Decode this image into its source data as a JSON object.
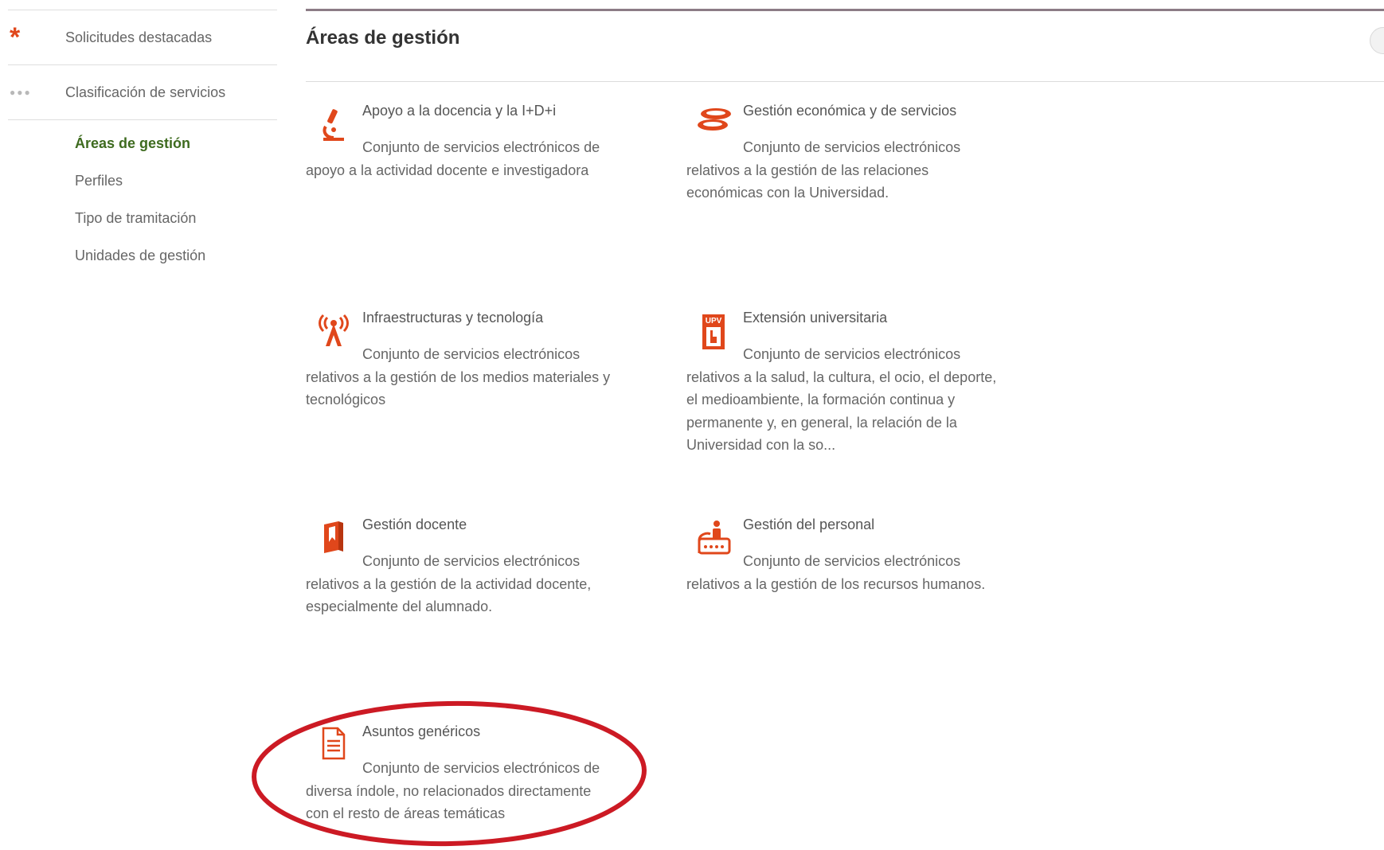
{
  "sidebar": {
    "featured": {
      "label": "Solicitudes destacadas",
      "icon": "asterisk-icon"
    },
    "classification": {
      "label": "Clasificación de servicios",
      "icon": "ellipsis-icon"
    },
    "subitems": [
      {
        "label": "Áreas de gestión",
        "active": true
      },
      {
        "label": "Perfiles",
        "active": false
      },
      {
        "label": "Tipo de tramitación",
        "active": false
      },
      {
        "label": "Unidades de gestión",
        "active": false
      }
    ]
  },
  "main": {
    "title": "Áreas de gestión",
    "areas": [
      {
        "title": "Apoyo a la docencia y la I+D+i",
        "description": "Conjunto de servicios electrónicos de apoyo a la actividad docente e investigadora",
        "icon": "microscope-icon"
      },
      {
        "title": "Gestión económica y de servicios",
        "description": "Conjunto de servicios electrónicos relativos a la gestión de las relaciones económicas con la Universidad.",
        "icon": "coins-icon"
      },
      {
        "title": "Infraestructuras y tecnología",
        "description": "Conjunto de servicios electrónicos relativos a la gestión de los medios materiales y tecnológicos",
        "icon": "antenna-icon"
      },
      {
        "title": "Extensión universitaria",
        "description": "Conjunto de servicios electrónicos relativos a la salud, la cultura, el ocio, el deporte, el medioambiente, la formación continua y permanente y, en general, la relación de la Universidad con la so...",
        "icon": "upv-extension-icon",
        "badge": "UPV"
      },
      {
        "title": "Gestión docente",
        "description": "Conjunto de servicios electrónicos relativos a la gestión de la actividad docente, especialmente del alumnado.",
        "icon": "book-icon"
      },
      {
        "title": "Gestión del personal",
        "description": "Conjunto de servicios electrónicos relativos a la gestión de los recursos humanos.",
        "icon": "staff-icon"
      },
      {
        "title": "Asuntos genéricos",
        "description": "Conjunto de servicios electrónicos de diversa índole, no relacionados directamente con el resto de áreas temáticas",
        "icon": "document-icon",
        "highlighted": true
      }
    ]
  },
  "colors": {
    "accent_orange": "#e0471b",
    "active_green": "#3e6b1f",
    "highlight_red": "#cc1a24"
  }
}
